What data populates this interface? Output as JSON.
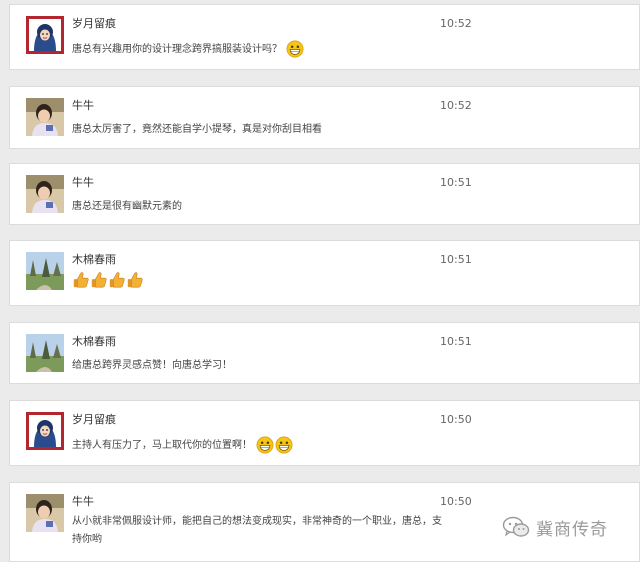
{
  "comments": [
    {
      "user": "岁月留痕",
      "avatar": "cartoon-avatar",
      "time": "10:52",
      "text": "唐总有兴趣用你的设计理念跨界搞服装设计吗？",
      "emojis": [
        "grin-emoji"
      ]
    },
    {
      "user": "牛牛",
      "avatar": "photo-avatar-child",
      "time": "10:52",
      "text": "唐总太厉害了，竟然还能自学小提琴，真是对你刮目相看"
    },
    {
      "user": "牛牛",
      "avatar": "photo-avatar-child",
      "time": "10:51",
      "text": "唐总还是很有幽默元素的"
    },
    {
      "user": "木棉春雨",
      "avatar": "photo-avatar-landscape",
      "time": "10:51",
      "text": "",
      "emojis": [
        "thumbs-up-emoji",
        "thumbs-up-emoji",
        "thumbs-up-emoji",
        "thumbs-up-emoji"
      ]
    },
    {
      "user": "木棉春雨",
      "avatar": "photo-avatar-landscape",
      "time": "10:51",
      "text": "给唐总跨界灵感点赞！向唐总学习！"
    },
    {
      "user": "岁月留痕",
      "avatar": "cartoon-avatar",
      "time": "10:50",
      "text": "主持人有压力了，马上取代你的位置啊！",
      "emojis": [
        "grin-emoji",
        "grin-emoji"
      ]
    },
    {
      "user": "牛牛",
      "avatar": "photo-avatar-child",
      "time": "10:50",
      "text": "从小就非常佩服设计师，能把自己的想法变成现实，非常神奇的一个职业，唐总，支持你哟"
    }
  ],
  "watermark": {
    "text": "冀商传奇",
    "icon": "wechat-icon"
  },
  "colors": {
    "background": "#ebebeb",
    "card": "#ffffff",
    "border": "#dcdcdc",
    "emoji": "#f5c518",
    "thumb": "#f2b134"
  }
}
